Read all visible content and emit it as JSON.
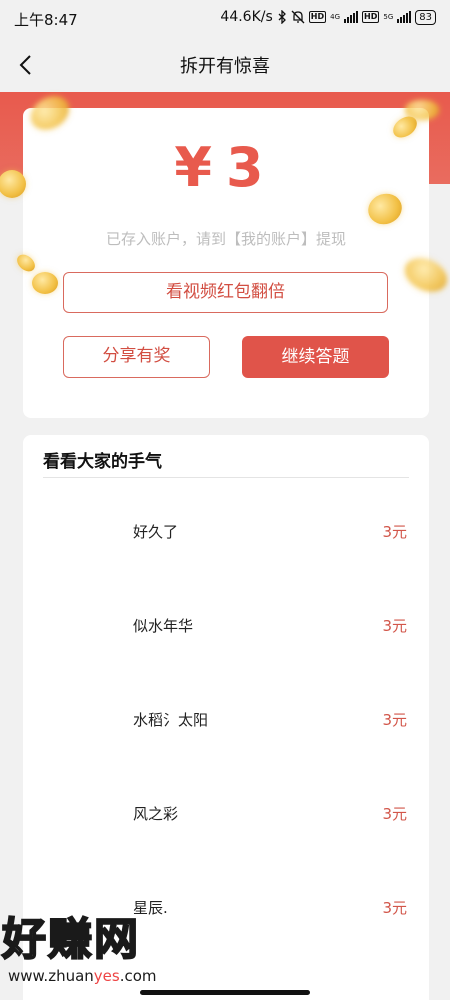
{
  "status_bar": {
    "time": "上午8:47",
    "speed": "44.6K/s",
    "net_4g": "4G",
    "net_5g": "5G",
    "battery": "83"
  },
  "nav": {
    "title": "拆开有惊喜"
  },
  "reward": {
    "amount": "¥3",
    "note": "已存入账户，请到【我的账户】提现",
    "video_button": "看视频红包翻倍",
    "share_button": "分享有奖",
    "continue_button": "继续答题"
  },
  "list": {
    "header": "看看大家的手气",
    "rows": [
      {
        "name": "好久了",
        "amount": "3元"
      },
      {
        "name": "似水年华",
        "amount": "3元"
      },
      {
        "name": "水稻氵太阳",
        "amount": "3元"
      },
      {
        "name": "风之彩",
        "amount": "3元"
      },
      {
        "name": "星辰.",
        "amount": "3元"
      }
    ]
  },
  "watermark": {
    "main": "好赚网",
    "url_a": "www.zhuan",
    "url_b": "yes",
    "url_c": ".com"
  },
  "colors": {
    "accent": "#e85a4d",
    "amount_text": "#d2564a",
    "background": "#f1f1f1"
  }
}
